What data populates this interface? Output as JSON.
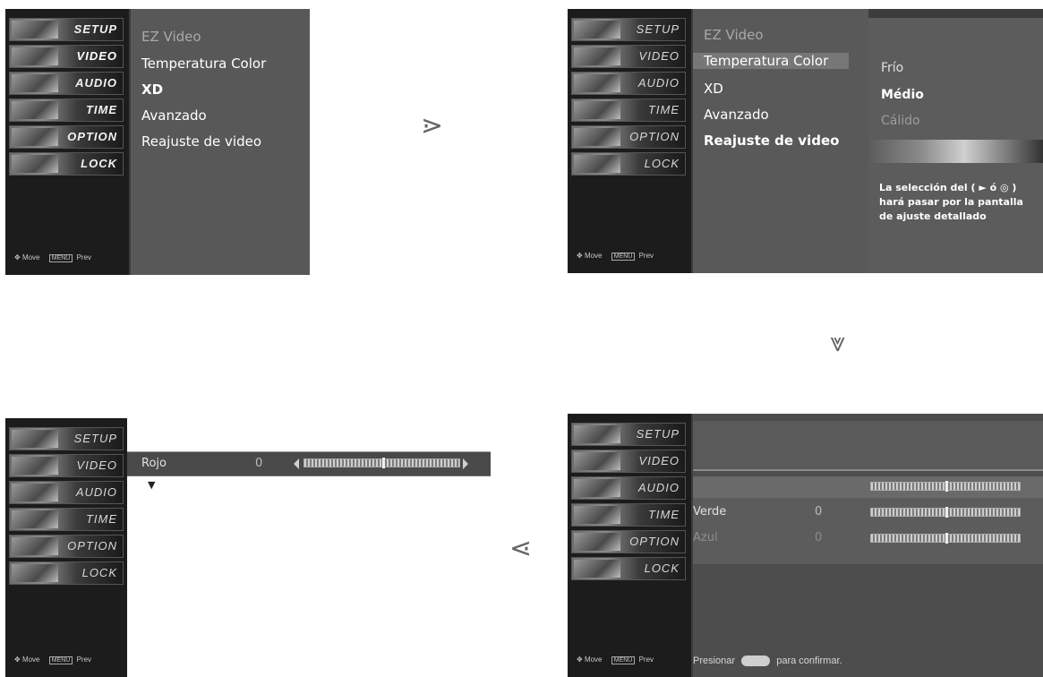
{
  "menu": {
    "items": [
      {
        "label": "SETUP"
      },
      {
        "label": "VIDEO"
      },
      {
        "label": "AUDIO"
      },
      {
        "label": "TIME"
      },
      {
        "label": "OPTION"
      },
      {
        "label": "LOCK"
      }
    ],
    "nav_move": "Move",
    "nav_key": "MENU",
    "nav_prev": "Prev"
  },
  "video_menu": {
    "options": [
      {
        "label": "EZ Video"
      },
      {
        "label": "Temperatura Color"
      },
      {
        "label": "XD"
      },
      {
        "label": "Avanzado"
      },
      {
        "label": "Reajuste de video"
      }
    ]
  },
  "temp_submenu": {
    "options": [
      {
        "label": "Frío"
      },
      {
        "label": "Médio"
      },
      {
        "label": "Cálido"
      }
    ],
    "help_line1": "La selección del ( ► ó ◎ )",
    "help_line2": "hará pasar por la pantalla",
    "help_line3": "de ajuste detallado"
  },
  "color_adjust": {
    "rows": [
      {
        "label": "Rojo",
        "value": "0"
      },
      {
        "label": "Verde",
        "value": "0"
      },
      {
        "label": "Azul",
        "value": "0"
      }
    ],
    "confirm_before": "Presionar",
    "confirm_after": "para confirmar."
  },
  "arrows": {
    "right": "⋗",
    "down": "⩔",
    "left": "⋖",
    "down_marker": "▼"
  }
}
